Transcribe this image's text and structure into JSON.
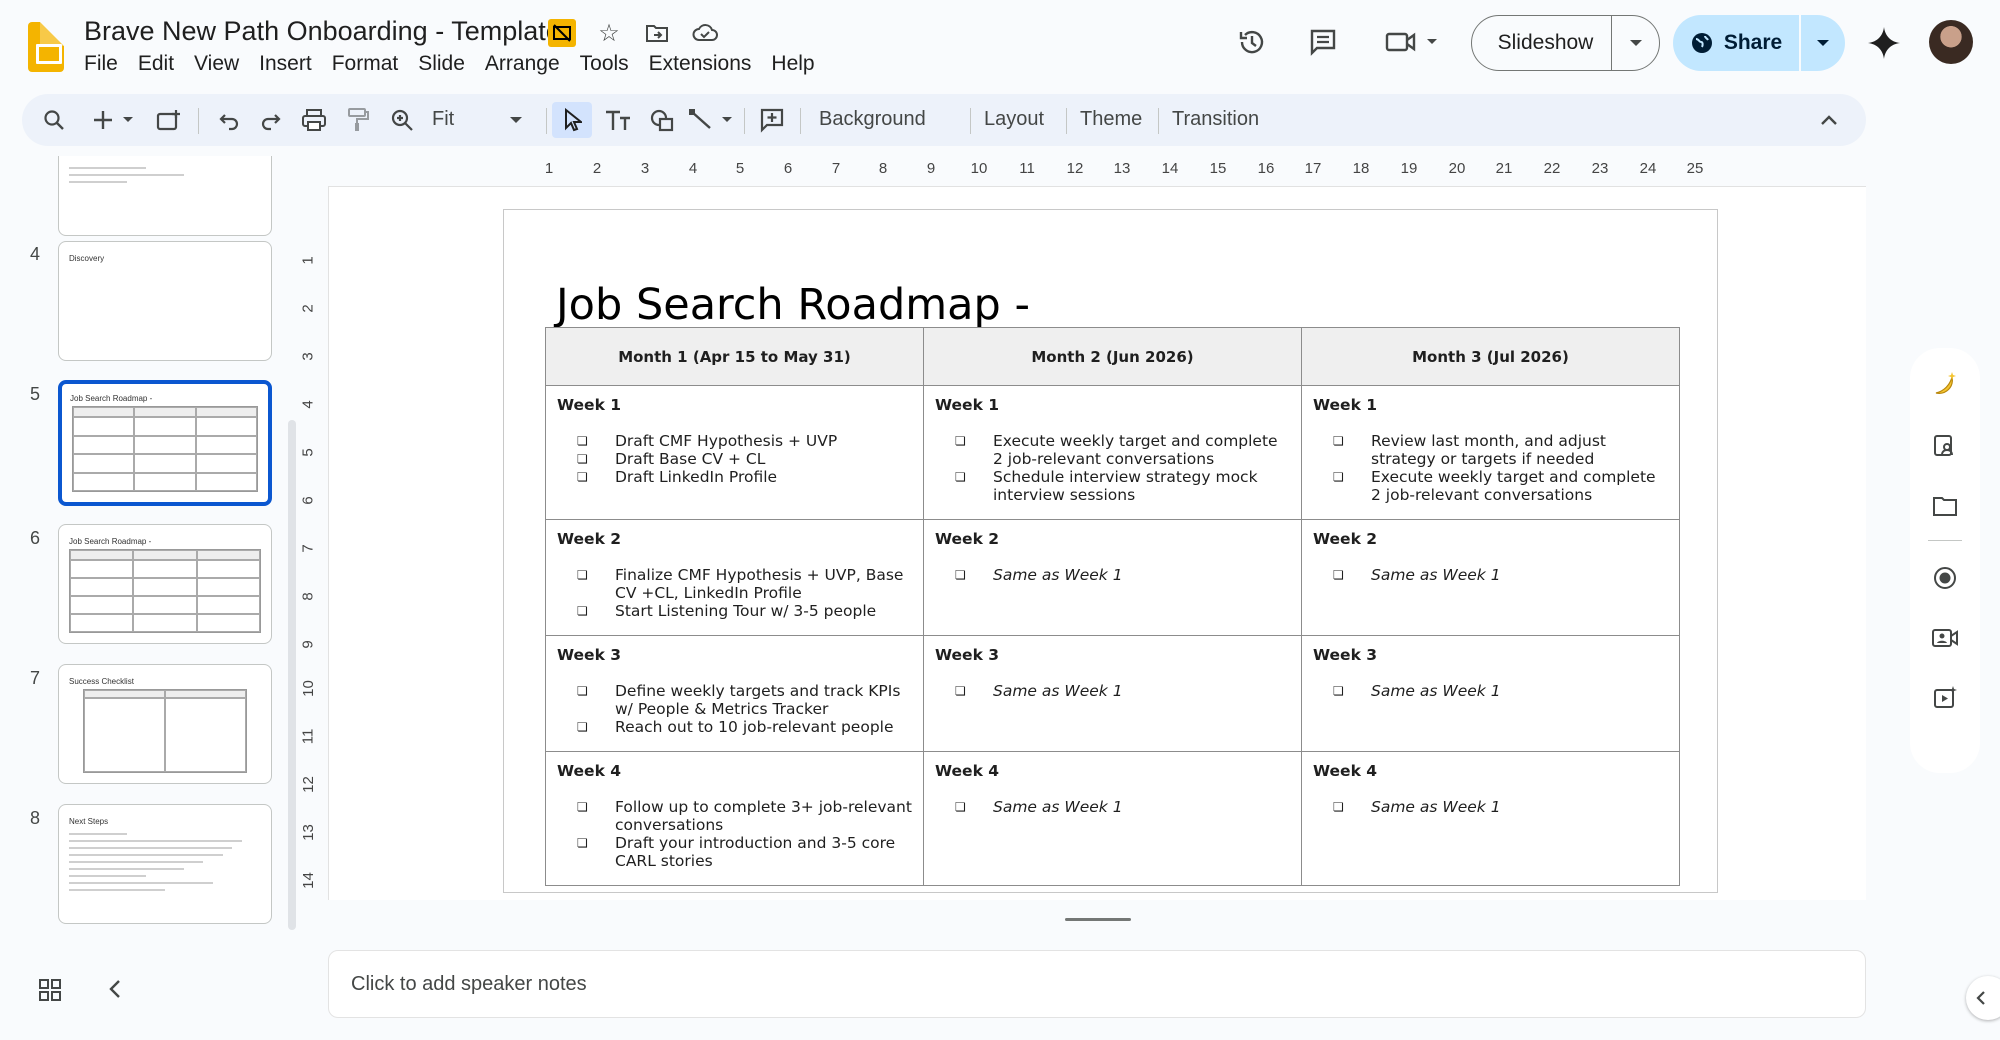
{
  "app": {
    "title": "Brave New Path Onboarding - Template",
    "menu": [
      "File",
      "Edit",
      "View",
      "Insert",
      "Format",
      "Slide",
      "Arrange",
      "Tools",
      "Extensions",
      "Help"
    ]
  },
  "header": {
    "slideshow_label": "Slideshow",
    "share_label": "Share",
    "accent_color": "#c2e7ff"
  },
  "toolbar": {
    "zoom_label": "Fit",
    "background_label": "Background",
    "layout_label": "Layout",
    "theme_label": "Theme",
    "transition_label": "Transition"
  },
  "filmstrip": {
    "slides": [
      {
        "num": "4",
        "title": "Discovery"
      },
      {
        "num": "5",
        "title": "Job Search Roadmap -",
        "selected": true
      },
      {
        "num": "6",
        "title": "Job Search Roadmap -"
      },
      {
        "num": "7",
        "title": "Success Checklist"
      },
      {
        "num": "8",
        "title": "Next Steps"
      }
    ]
  },
  "ruler": {
    "h": [
      "1",
      "2",
      "3",
      "4",
      "5",
      "6",
      "7",
      "8",
      "9",
      "10",
      "11",
      "12",
      "13",
      "14",
      "15",
      "16",
      "17",
      "18",
      "19",
      "20",
      "21",
      "22",
      "23",
      "24",
      "25"
    ],
    "v": [
      "1",
      "2",
      "3",
      "4",
      "5",
      "6",
      "7",
      "8",
      "9",
      "10",
      "11",
      "12",
      "13",
      "14"
    ]
  },
  "slide": {
    "title": "Job Search Roadmap -",
    "columns": [
      "Month 1 (Apr 15 to May 31)",
      "Month 2 (Jun 2026)",
      "Month 3 (Jul 2026)"
    ],
    "rows": [
      {
        "week": "Week 1",
        "cells": [
          [
            "Draft CMF Hypothesis + UVP",
            "Draft Base CV + CL",
            "Draft LinkedIn Profile"
          ],
          [
            "Execute weekly target and complete 2 job-relevant conversations",
            "Schedule interview strategy mock interview sessions"
          ],
          [
            "Review last month, and adjust strategy or targets if  needed",
            "Execute weekly target and complete 2 job-relevant conversations"
          ]
        ]
      },
      {
        "week": "Week 2",
        "cells": [
          [
            "Finalize CMF Hypothesis + UVP, Base CV +CL, LinkedIn Profile",
            "Start Listening Tour w/ 3-5 people"
          ],
          [
            "Same as Week 1"
          ],
          [
            "Same as Week 1"
          ]
        ]
      },
      {
        "week": "Week 3",
        "cells": [
          [
            "Define weekly targets and track KPIs w/ People & Metrics Tracker",
            "Reach out to 10 job-relevant people"
          ],
          [
            "Same as Week 1"
          ],
          [
            "Same as Week 1"
          ]
        ]
      },
      {
        "week": "Week 4",
        "cells": [
          [
            "Follow up to complete 3+ job-relevant conversations",
            "Draft your introduction and 3-5 core CARL stories"
          ],
          [
            "Same as Week 1"
          ],
          [
            "Same as Week 1"
          ]
        ]
      }
    ]
  },
  "notes": {
    "placeholder": "Click to add speaker notes"
  }
}
